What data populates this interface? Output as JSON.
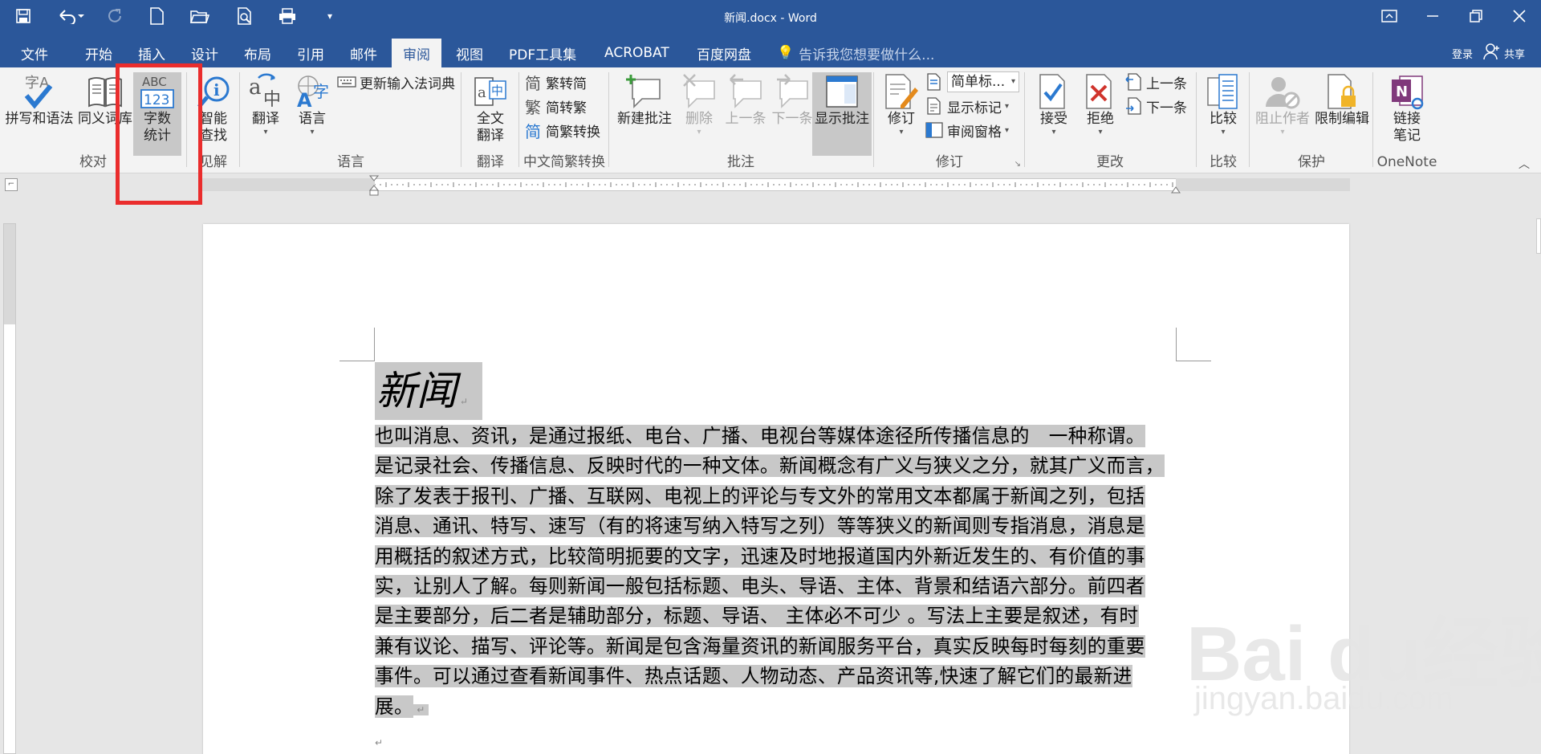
{
  "window": {
    "title": "新闻.docx - Word"
  },
  "tabs": [
    "文件",
    "开始",
    "插入",
    "设计",
    "布局",
    "引用",
    "邮件",
    "审阅",
    "视图",
    "PDF工具集",
    "ACROBAT",
    "百度网盘"
  ],
  "active_tab": "审阅",
  "tell_me": "告诉我您想要做什么...",
  "account": {
    "login": "登录",
    "share": "共享"
  },
  "ribbon": {
    "proofing": {
      "label": "校对",
      "spelling": "拼写和语法",
      "thesaurus": "同义词库",
      "wordcount": "字数\n统计",
      "wordcount_l1": "字数",
      "wordcount_l2": "统计"
    },
    "insights": {
      "label": "见解",
      "smart_l1": "智能",
      "smart_l2": "查找"
    },
    "language": {
      "label": "语言",
      "translate": "翻译",
      "lang": "语言",
      "update_ime": "更新输入法词典"
    },
    "translate_grp": {
      "label": "翻译",
      "full_l1": "全文",
      "full_l2": "翻译"
    },
    "chinese_conv": {
      "label": "中文简繁转换",
      "t2s": "繁转简",
      "s2t": "简转繁",
      "conv": "简繁转换"
    },
    "comments": {
      "label": "批注",
      "new": "新建批注",
      "delete": "删除",
      "prev": "上一条",
      "next": "下一条",
      "show": "显示批注"
    },
    "tracking": {
      "label": "修订",
      "track": "修订",
      "markup_select": "简单标...",
      "show_markup": "显示标记",
      "review_pane": "审阅窗格"
    },
    "changes": {
      "label": "更改",
      "accept": "接受",
      "reject": "拒绝",
      "prev": "上一条",
      "next": "下一条"
    },
    "compare": {
      "label": "比较",
      "compare": "比较"
    },
    "protect": {
      "label": "保护",
      "block": "阻止作者",
      "restrict": "限制编辑"
    },
    "onenote": {
      "label": "OneNote",
      "link_l1": "链接",
      "link_l2": "笔记"
    }
  },
  "document": {
    "heading": "新闻",
    "body": "也叫消息、资讯，是通过报纸、电台、广播、电视台等媒体途径所传播信息的　一种称谓。是记录社会、传播信息、反映时代的一种文体。新闻概念有广义与狭义之分，就其广义而言，除了发表于报刊、广播、互联网、电视上的评论与专文外的常用文本都属于新闻之列，包括消息、通讯、特写、速写（有的将速写纳入特写之列）等等狭义的新闻则专指消息，消息是用概括的叙述方式，比较简明扼要的文字，迅速及时地报道国内外新近发生的、有价值的事实，让别人了解。每则新闻一般包括标题、电头、导语、主体、背景和结语六部分。前四者是主要部分，后二者是辅助部分，标题、导语、 主体必不可少 。写法上主要是叙述，有时兼有议论、描写、评论等。新闻是包含海量资讯的新闻服务平台，真实反映每时每刻的重要事件。可以通过查看新闻事件、热点话题、人物动态、产品资讯等,快速了解它们的最新进展。",
    "lines": [
      "也叫消息、资讯，是通过报纸、电台、广播、电视台等媒体途径所传播信息的　一种称谓。",
      "是记录社会、传播信息、反映时代的一种文体。新闻概念有广义与狭义之分，就其广义而言，",
      "除了发表于报刊、广播、互联网、电视上的评论与专文外的常用文本都属于新闻之列，包括",
      "消息、通讯、特写、速写（有的将速写纳入特写之列）等等狭义的新闻则专指消息，消息是",
      "用概括的叙述方式，比较简明扼要的文字，迅速及时地报道国内外新近发生的、有价值的事",
      "实，让别人了解。每则新闻一般包括标题、电头、导语、主体、背景和结语六部分。前四者",
      "是主要部分，后二者是辅助部分，标题、导语、 主体必不可少 。写法上主要是叙述，有时",
      "兼有议论、描写、评论等。新闻是包含海量资讯的新闻服务平台，真实反映每时每刻的重要",
      "事件。可以通过查看新闻事件、热点话题、人物动态、产品资讯等,快速了解它们的最新进",
      "展。"
    ]
  },
  "watermark": {
    "brand": "Bai du经验",
    "url": "jingyan.baidu.com"
  },
  "colors": {
    "titlebar": "#2b579a",
    "ribbon": "#f3f3f3",
    "highlight": "#c8c8c8",
    "red_box": "#ea2d2d"
  }
}
